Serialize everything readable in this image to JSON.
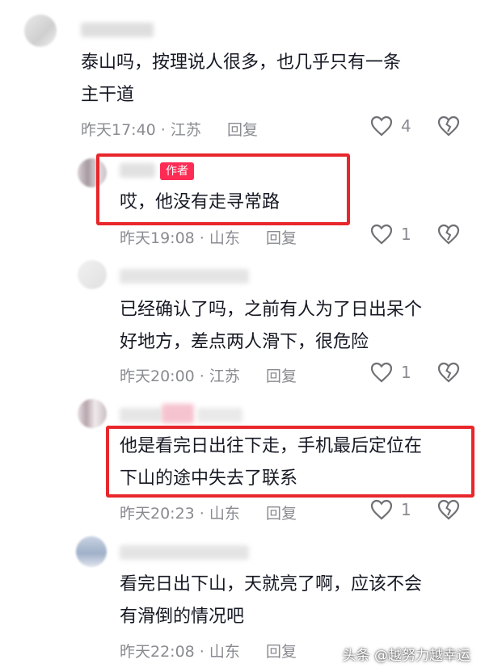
{
  "comments": [
    {
      "line1": "泰山吗，按理说人很多，也几乎只有一条",
      "line2": "主干道",
      "time": "昨天17:40",
      "location": "江苏",
      "reply_label": "回复",
      "likes": "4"
    },
    {
      "badge": "作者",
      "line1": "哎，他没有走寻常路",
      "time": "昨天19:08",
      "location": "山东",
      "reply_label": "回复",
      "likes": "1"
    },
    {
      "line1": "已经确认了吗，之前有人为了日出呆个",
      "line2": "好地方，差点两人滑下，很危险",
      "time": "昨天20:00",
      "location": "江苏",
      "reply_label": "回复",
      "likes": "1"
    },
    {
      "line1": "他是看完日出往下走，手机最后定位在",
      "line2": "下山的途中失去了联系",
      "time": "昨天20:23",
      "location": "山东",
      "reply_label": "回复",
      "likes": "1"
    },
    {
      "line1": "看完日出下山，天就亮了啊，应该不会",
      "line2": "有滑倒的情况吧",
      "time": "昨天22:08",
      "location": "山东",
      "reply_label": "回复"
    }
  ],
  "separator": " · ",
  "watermark": "头条 @越努力越幸运",
  "icons": {
    "like": "heart-outline-icon",
    "dislike": "broken-heart-icon"
  },
  "colors": {
    "highlight": "#e8272c",
    "badge": "#fe2c55",
    "meta": "#8a8b91"
  }
}
